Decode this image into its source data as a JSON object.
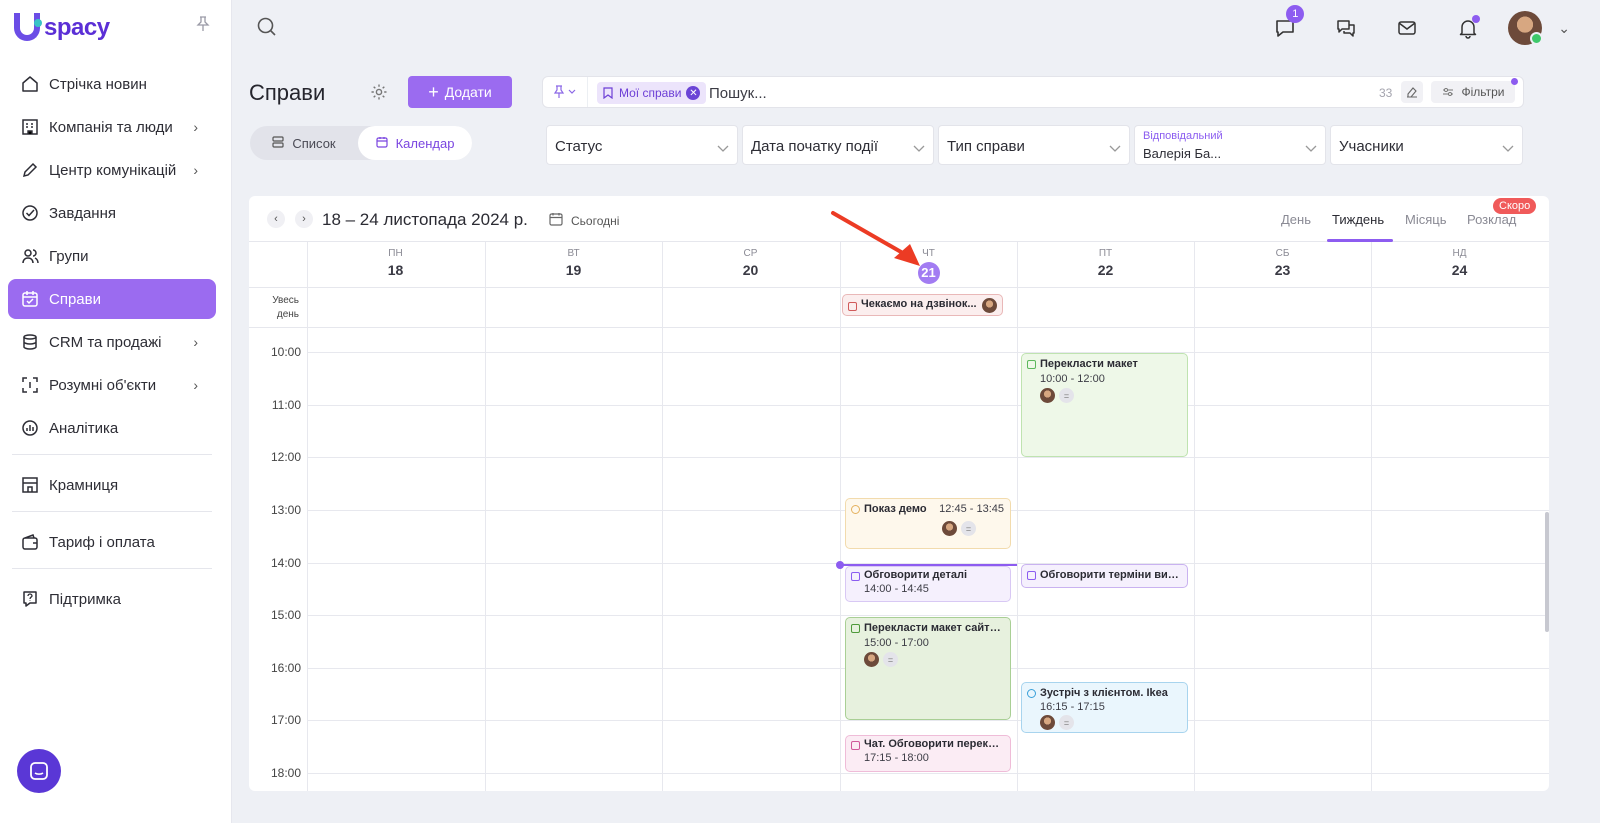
{
  "sidebar": {
    "logo": "spacy",
    "items": [
      {
        "label": "Стрічка новин",
        "icon": "home-icon"
      },
      {
        "label": "Компанія та люди",
        "icon": "company-icon",
        "chevron": true
      },
      {
        "label": "Центр комунікацій",
        "icon": "edit-icon",
        "chevron": true
      },
      {
        "label": "Завдання",
        "icon": "check-circle-icon"
      },
      {
        "label": "Групи",
        "icon": "users-icon"
      },
      {
        "label": "Справи",
        "icon": "calendar-check-icon",
        "active": true
      },
      {
        "label": "CRM та продажі",
        "icon": "database-icon",
        "chevron": true
      },
      {
        "label": "Розумні об'єкти",
        "icon": "scan-icon",
        "chevron": true
      },
      {
        "label": "Аналітика",
        "icon": "analytics-icon"
      },
      {
        "label": "Крамниця",
        "icon": "store-icon"
      },
      {
        "label": "Тариф і оплата",
        "icon": "wallet-icon"
      },
      {
        "label": "Підтримка",
        "icon": "help-icon"
      }
    ]
  },
  "topbar": {
    "messages_badge": "1"
  },
  "page": {
    "title": "Справи",
    "add_button": "Додати",
    "view_list": "Список",
    "view_calendar": "Календар"
  },
  "search": {
    "chip": "Мої справи",
    "placeholder": "Пошук...",
    "count": "33",
    "filters_button": "Фільтри"
  },
  "filters": {
    "status": "Статус",
    "start_date": "Дата початку події",
    "type": "Тип справи",
    "responsible_label": "Відповідальний",
    "responsible_value": "Валерія Ба...",
    "participants": "Учасники"
  },
  "calendar": {
    "range": "18 – 24 листопада 2024 р.",
    "today": "Сьогодні",
    "views": [
      "День",
      "Тиждень",
      "Місяць",
      "Розклад"
    ],
    "active_view": "Тиждень",
    "soon_badge": "Скоро",
    "allday_label": "Увесь день",
    "days": [
      {
        "name": "ПН",
        "num": "18"
      },
      {
        "name": "ВТ",
        "num": "19"
      },
      {
        "name": "СР",
        "num": "20"
      },
      {
        "name": "ЧТ",
        "num": "21",
        "today": true
      },
      {
        "name": "ПТ",
        "num": "22"
      },
      {
        "name": "СБ",
        "num": "23"
      },
      {
        "name": "НД",
        "num": "24"
      }
    ],
    "hours": [
      "10:00",
      "11:00",
      "12:00",
      "13:00",
      "14:00",
      "15:00",
      "16:00",
      "17:00",
      "18:00"
    ],
    "events": {
      "allday_thu": {
        "title": "Чекаємо на дзвінок..."
      },
      "translate_fri": {
        "title": "Перекласти макет",
        "time": "10:00 - 12:00"
      },
      "demo_thu": {
        "title": "Показ демо",
        "time": "12:45 - 13:45"
      },
      "discuss_thu": {
        "title": "Обговорити деталі",
        "time": "14:00 - 14:45"
      },
      "terms_fri": {
        "title": "Обговорити терміни вик..."
      },
      "site_thu": {
        "title": "Перекласти макет сайту...",
        "time": "15:00 - 17:00"
      },
      "meeting_fri": {
        "title": "Зустріч з клієнтом. Ikea",
        "time": "16:15 - 17:15"
      },
      "chat_thu": {
        "title": "Чат. Обговорити перекл...",
        "time": "17:15 - 18:00"
      }
    }
  },
  "colors": {
    "accent": "#9b6bf0",
    "active_nav": "#9b6bf0",
    "soon_badge": "#f05a5a"
  }
}
